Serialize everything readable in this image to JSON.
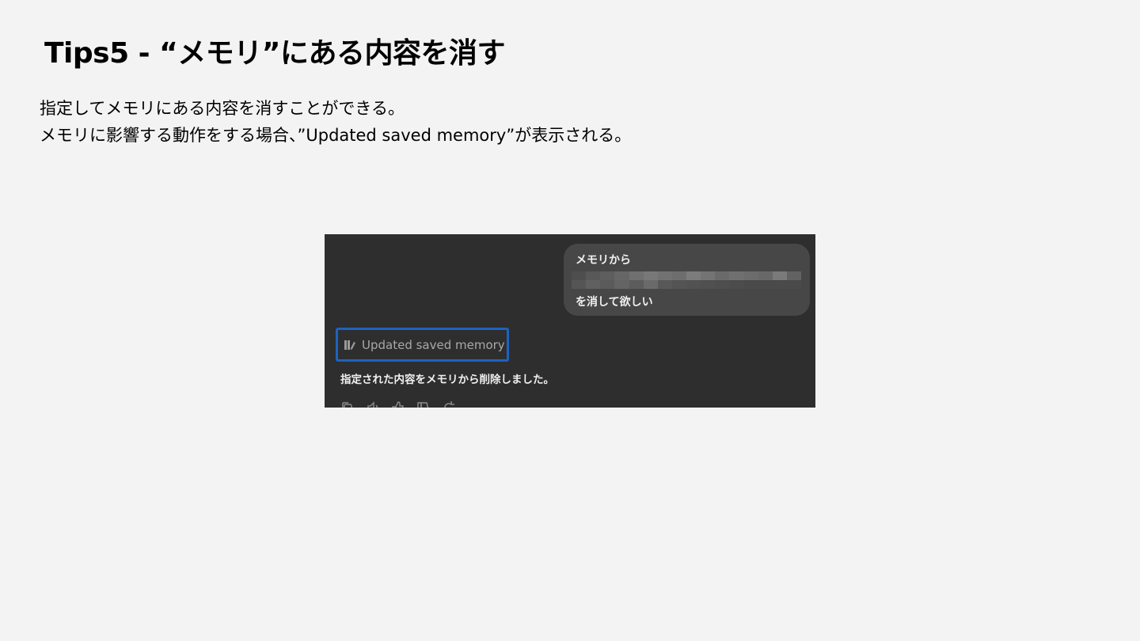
{
  "title": "Tips5 - “メモリ”にある内容を消す",
  "description": {
    "line1": "指定してメモリにある内容を消すことができる。",
    "line2": "メモリに影響する動作をする場合、”Updated saved memory”が表示される。"
  },
  "screenshot": {
    "user_message": {
      "line1": "メモリから",
      "line3": "を消して欲しい"
    },
    "memory_notice": {
      "icon": "memory-pen-icon",
      "label": "Updated saved memory",
      "highlight_color": "#1e63c0"
    },
    "assistant_message": "指定された内容をメモリから削除しました。",
    "action_icons": [
      "copy-icon",
      "speaker-icon",
      "thumbs-up-icon",
      "thumbs-down-icon",
      "regenerate-icon"
    ]
  },
  "colors": {
    "page_background": "#f3f3f3",
    "chat_background": "#2e2e2e",
    "bubble_background": "#474747"
  }
}
